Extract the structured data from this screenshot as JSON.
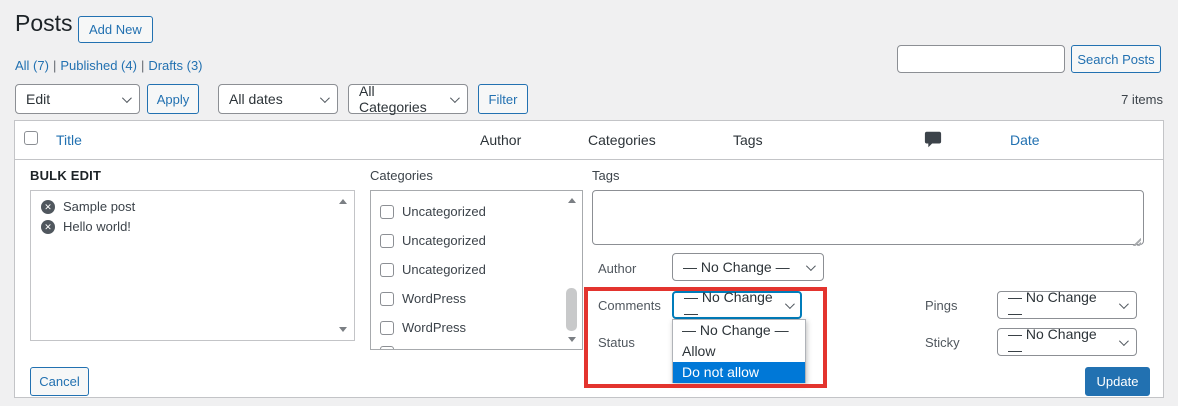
{
  "header": {
    "title": "Posts",
    "add_new_label": "Add New"
  },
  "views": {
    "items": [
      "All (7)",
      "Published (4)",
      "Drafts (3)"
    ],
    "separator": "|"
  },
  "toolbar": {
    "bulk_action_select": "Edit",
    "apply_label": "Apply",
    "dates_select": "All dates",
    "categories_select": "All Categories",
    "filter_label": "Filter",
    "items_count": "7 items"
  },
  "search": {
    "value": "",
    "button_label": "Search Posts"
  },
  "table_header": {
    "title": "Title",
    "author": "Author",
    "categories": "Categories",
    "tags": "Tags",
    "comments_icon": "comment-bubble",
    "date": "Date"
  },
  "bulk_edit": {
    "legend": "BULK EDIT",
    "selected_posts": [
      "Sample post",
      "Hello world!"
    ],
    "categories_label": "Categories",
    "category_items": [
      "Uncategorized",
      "Uncategorized",
      "Uncategorized",
      "WordPress",
      "WordPress"
    ],
    "tags_label": "Tags",
    "tags_value": "",
    "author_label": "Author",
    "comments_label": "Comments",
    "status_label": "Status",
    "pings_label": "Pings",
    "sticky_label": "Sticky",
    "no_change": "— No Change —",
    "comments_dropdown": {
      "options": [
        "— No Change —",
        "Allow",
        "Do not allow"
      ],
      "highlighted": "Do not allow"
    },
    "cancel_label": "Cancel",
    "update_label": "Update"
  },
  "colors": {
    "accent_link": "#2271b1",
    "primary_button": "#2271b1",
    "focus_border": "#007cba",
    "menu_highlight": "#0078d7",
    "annotation_red": "#e3342e",
    "background": "#f0f0f1"
  }
}
